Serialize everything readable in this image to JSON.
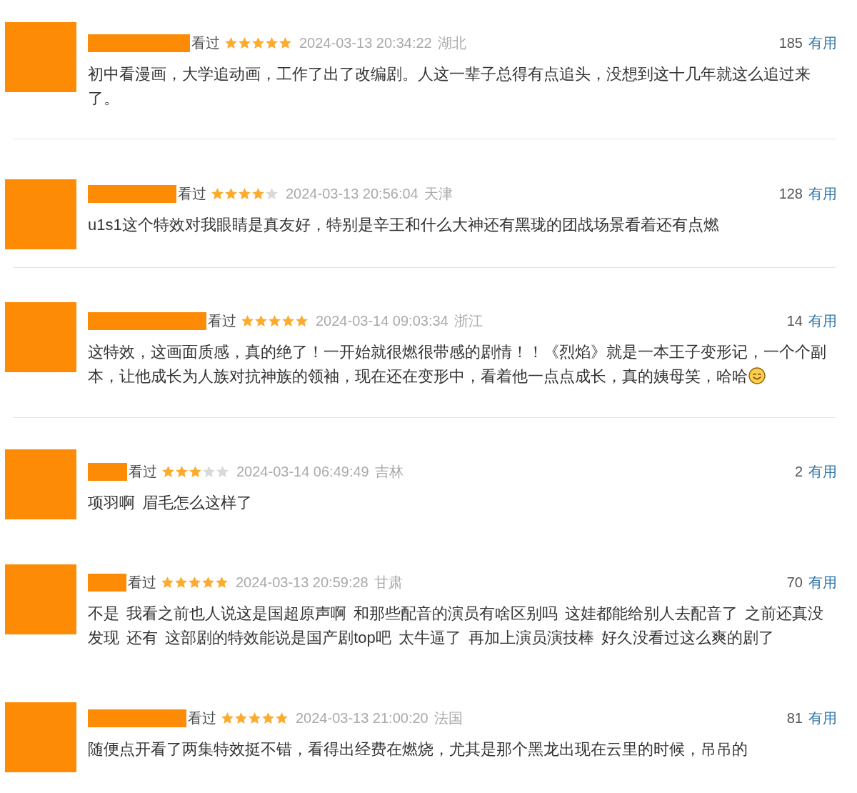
{
  "comments": [
    {
      "status": "看过",
      "stars": 5,
      "time": "2024-03-13 20:34:22",
      "location": "湖北",
      "votes": "185",
      "useful": "有用",
      "text": "初中看漫画，大学追动画，工作了出了改编剧。人这一辈子总得有点追头，没想到这十几年就这么追过来了。",
      "emoji": false,
      "divider": true
    },
    {
      "status": "看过",
      "stars": 4,
      "time": "2024-03-13 20:56:04",
      "location": "天津",
      "votes": "128",
      "useful": "有用",
      "text": "u1s1这个特效对我眼睛是真友好，特别是辛王和什么大神还有黑珑的团战场景看着还有点燃",
      "emoji": false,
      "divider": true
    },
    {
      "status": "看过",
      "stars": 5,
      "time": "2024-03-14 09:03:34",
      "location": "浙江",
      "votes": "14",
      "useful": "有用",
      "text": "这特效，这画面质感，真的绝了！一开始就很燃很带感的剧情！！《烈焰》就是一本王子变形记，一个个副本，让他成长为人族对抗神族的领袖，现在还在变形中，看着他一点点成长，真的姨母笑，哈哈",
      "emoji": true,
      "divider": true
    },
    {
      "status": "看过",
      "stars": 3,
      "time": "2024-03-14 06:49:49",
      "location": "吉林",
      "votes": "2",
      "useful": "有用",
      "text": "项羽啊 眉毛怎么这样了",
      "emoji": false,
      "divider": false
    },
    {
      "status": "看过",
      "stars": 5,
      "time": "2024-03-13 20:59:28",
      "location": "甘肃",
      "votes": "70",
      "useful": "有用",
      "text": "不是 我看之前也人说这是国超原声啊 和那些配音的演员有啥区别吗 这娃都能给别人去配音了 之前还真没发现 还有 这部剧的特效能说是国产剧top吧 太牛逼了 再加上演员演技棒 好久没看过这么爽的剧了",
      "emoji": false,
      "divider": false
    },
    {
      "status": "看过",
      "stars": 5,
      "time": "2024-03-13 21:00:20",
      "location": "法国",
      "votes": "81",
      "useful": "有用",
      "text": "随便点开看了两集特效挺不错，看得出经费在燃烧，尤其是那个黑龙出现在云里的时候，吊吊的",
      "emoji": false,
      "divider": false
    }
  ]
}
